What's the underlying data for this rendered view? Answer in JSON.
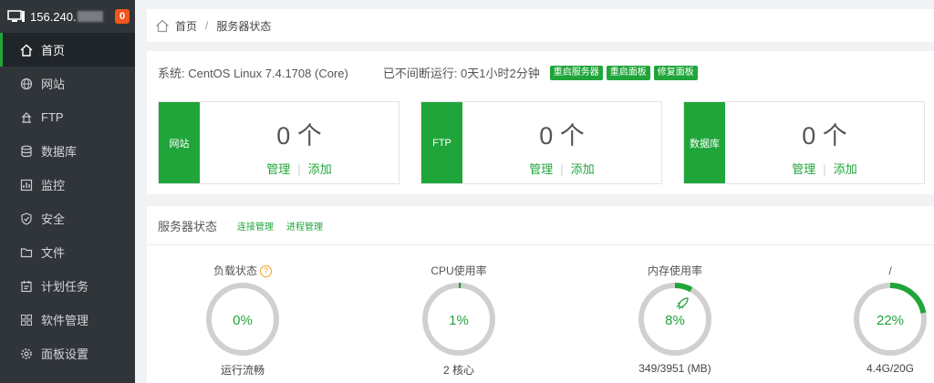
{
  "sidebar": {
    "ip": "156.240.",
    "badge": "0",
    "items": [
      {
        "label": "首页",
        "icon": "home-icon"
      },
      {
        "label": "网站",
        "icon": "globe-icon"
      },
      {
        "label": "FTP",
        "icon": "ftp-icon"
      },
      {
        "label": "数据库",
        "icon": "database-icon"
      },
      {
        "label": "监控",
        "icon": "monitor-icon"
      },
      {
        "label": "安全",
        "icon": "shield-icon"
      },
      {
        "label": "文件",
        "icon": "folder-icon"
      },
      {
        "label": "计划任务",
        "icon": "calendar-icon"
      },
      {
        "label": "软件管理",
        "icon": "apps-icon"
      },
      {
        "label": "面板设置",
        "icon": "settings-icon"
      }
    ]
  },
  "breadcrumb": {
    "home": "首页",
    "current": "服务器状态"
  },
  "system": {
    "os": "系统: CentOS Linux 7.4.1708 (Core)",
    "uptime": "已不间断运行: 0天1小时2分钟",
    "buttons": [
      "重启服务器",
      "重启面板",
      "修复面板"
    ]
  },
  "cards": [
    {
      "label": "网站",
      "count": "0 个",
      "manage": "管理",
      "add": "添加"
    },
    {
      "label": "FTP",
      "count": "0 个",
      "manage": "管理",
      "add": "添加"
    },
    {
      "label": "数据库",
      "count": "0 个",
      "manage": "管理",
      "add": "添加"
    }
  ],
  "status": {
    "title": "服务器状态",
    "links": [
      "连接管理",
      "进程管理"
    ],
    "gauges": [
      {
        "title": "负载状态",
        "value": "0%",
        "percent": 0,
        "sub": "运行流畅",
        "help": "?"
      },
      {
        "title": "CPU使用率",
        "value": "1%",
        "percent": 1,
        "sub": "2 核心"
      },
      {
        "title": "内存使用率",
        "value": "8%",
        "percent": 8,
        "sub": "349/3951 (MB)"
      },
      {
        "title": "/",
        "value": "22%",
        "percent": 22,
        "sub": "4.4G/20G"
      }
    ]
  },
  "colors": {
    "accent": "#20a53a",
    "sidebar": "#30353a",
    "badge": "#f0561d"
  }
}
